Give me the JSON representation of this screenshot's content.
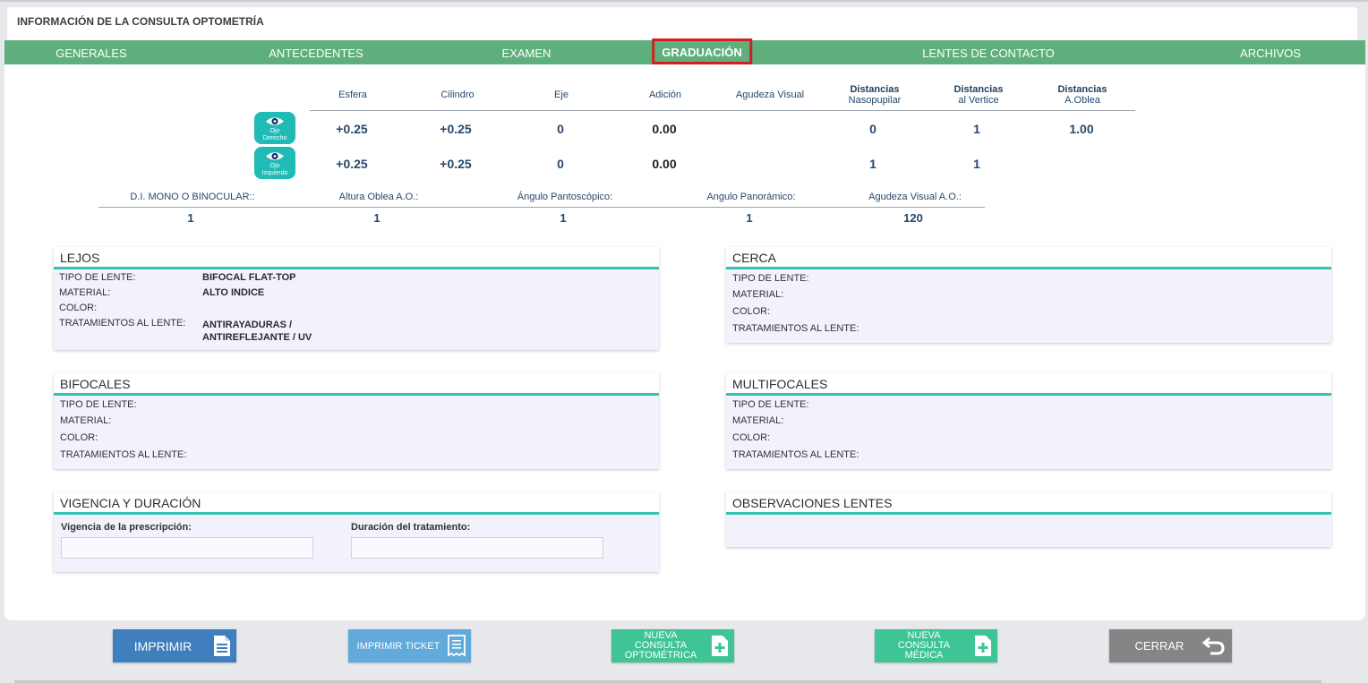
{
  "header": {
    "title": "INFORMACIÓN DE LA CONSULTA OPTOMETRÍA"
  },
  "tabs": [
    {
      "label": "GENERALES"
    },
    {
      "label": "ANTECEDENTES"
    },
    {
      "label": "EXAMEN"
    },
    {
      "label": "GRADUACIÓN",
      "active": true
    },
    {
      "label": "LENTES DE CONTACTO"
    },
    {
      "label": "ARCHIVOS"
    }
  ],
  "graduacion": {
    "columns": {
      "esfera": "Esfera",
      "cilindro": "Cilindro",
      "eje": "Eje",
      "adicion": "Adición",
      "agudeza": "Agudeza Visual",
      "dn_b": "Distancias",
      "dn_s": "Nasopupilar",
      "dv_b": "Distancias",
      "dv_s": "al Vertice",
      "da_b": "Distancias",
      "da_s": "A.Oblea"
    },
    "right_eye": {
      "icon_label_1": "Ojo",
      "icon_label_2": "Derecho",
      "esfera": "+0.25",
      "cilindro": "+0.25",
      "eje": "0",
      "adicion": "0.00",
      "agudeza": "",
      "nasopupilar": "0",
      "vertice": "1",
      "oblea": "1.00"
    },
    "left_eye": {
      "icon_label_1": "Ojo",
      "icon_label_2": "Izquierdo",
      "esfera": "+0.25",
      "cilindro": "+0.25",
      "eje": "0",
      "adicion": "0.00",
      "agudeza": "",
      "nasopupilar": "1",
      "vertice": "1",
      "oblea": ""
    }
  },
  "extra": {
    "labels": [
      "D.I. MONO O BINOCULAR::",
      "Altura Oblea A.O.:",
      "Ángulo Pantoscópico:",
      "Angulo Panorámico:",
      "Agudeza Visual A.O.:"
    ],
    "values": [
      "1",
      "1",
      "1",
      "1",
      "120"
    ]
  },
  "lejos": {
    "title": "LEJOS",
    "tipo_label": "TIPO DE LENTE:",
    "tipo_value": "BIFOCAL FLAT-TOP",
    "material_label": "MATERIAL:",
    "material_value": "ALTO INDICE",
    "color_label": "COLOR:",
    "color_value": "",
    "trat_label": "TRATAMIENTOS AL LENTE:",
    "trat_value_1": "ANTIRAYADURAS /",
    "trat_value_2": "ANTIREFLEJANTE / UV"
  },
  "cerca": {
    "title": "CERCA",
    "tipo_label": "TIPO DE LENTE:",
    "material_label": "MATERIAL:",
    "color_label": "COLOR:",
    "trat_label": "TRATAMIENTOS AL LENTE:"
  },
  "bifocales": {
    "title": "BIFOCALES",
    "tipo_label": "TIPO DE LENTE:",
    "material_label": "MATERIAL:",
    "color_label": "COLOR:",
    "trat_label": "TRATAMIENTOS AL LENTE:"
  },
  "multifocales": {
    "title": "MULTIFOCALES",
    "tipo_label": "TIPO DE LENTE:",
    "material_label": "MATERIAL:",
    "color_label": "COLOR:",
    "trat_label": "TRATAMIENTOS AL LENTE:"
  },
  "vigencia": {
    "title": "VIGENCIA Y DURACIÓN",
    "vigencia_label": "Vigencia de la prescripción:",
    "vigencia_value": "",
    "duracion_label": "Duración del tratamiento:",
    "duracion_value": ""
  },
  "observaciones": {
    "title": "OBSERVACIONES LENTES"
  },
  "buttons": {
    "imprimir": "IMPRIMIR",
    "ticket": "IMPRIMIR TICKET",
    "nueva_opt_1": "NUEVA",
    "nueva_opt_2": "CONSULTA",
    "nueva_opt_3": "OPTOMÉTRICA",
    "nueva_med_1": "NUEVA",
    "nueva_med_2": "CONSULTA",
    "nueva_med_3": "MÉDICA",
    "cerrar": "CERRAR"
  },
  "colors": {
    "tab_bar": "#5faf7c",
    "accent": "#34c2b4",
    "eye_icon": "#1fbbb4",
    "active_tab_border": "#d51e24",
    "btn_print": "#3f7fbd",
    "btn_ticket": "#62a9dc",
    "btn_new": "#3fc496",
    "btn_close": "#858585"
  },
  "icons": {
    "eye": "eye-icon",
    "document": "document-icon",
    "receipt": "receipt-icon",
    "add": "add-document-icon",
    "return": "return-arrow-icon"
  }
}
